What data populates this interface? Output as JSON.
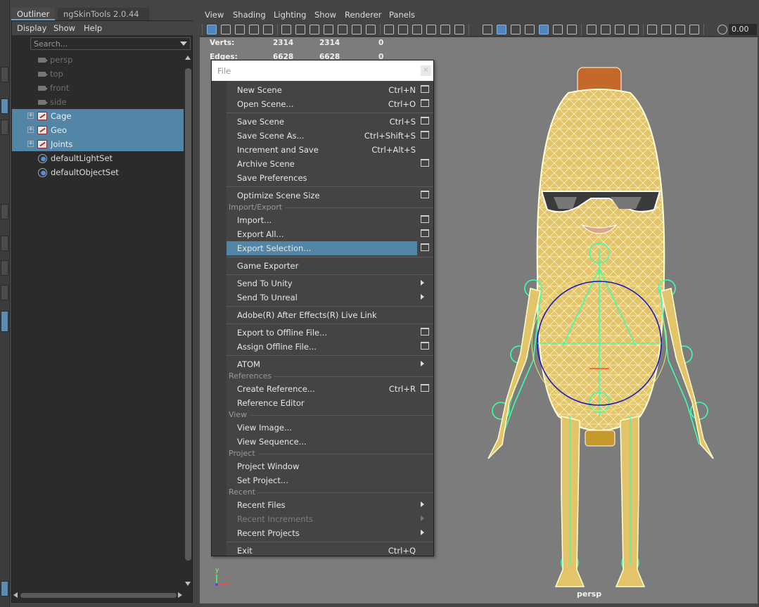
{
  "outliner": {
    "tabs": [
      "Outliner",
      "ngSkinTools 2.0.44"
    ],
    "menu": [
      "Display",
      "Show",
      "Help"
    ],
    "search_placeholder": "Search...",
    "items": [
      {
        "label": "persp",
        "type": "camera",
        "selected": false
      },
      {
        "label": "top",
        "type": "camera",
        "selected": false
      },
      {
        "label": "front",
        "type": "camera",
        "selected": false
      },
      {
        "label": "side",
        "type": "camera",
        "selected": false
      },
      {
        "label": "Cage",
        "type": "group",
        "selected": true
      },
      {
        "label": "Geo",
        "type": "group",
        "selected": true
      },
      {
        "label": "Joints",
        "type": "group",
        "selected": true
      },
      {
        "label": "defaultLightSet",
        "type": "set",
        "selected": false
      },
      {
        "label": "defaultObjectSet",
        "type": "set",
        "selected": false
      }
    ]
  },
  "viewport": {
    "menu": [
      "View",
      "Shading",
      "Lighting",
      "Show",
      "Renderer",
      "Panels"
    ],
    "toolbar_value": "0.00",
    "hud": {
      "verts_label": "Verts:",
      "verts_values": [
        "2314",
        "2314",
        "0"
      ],
      "edges_label": "Edges:",
      "edges_values": [
        "6628",
        "6628",
        "0"
      ]
    },
    "camera_label": "persp",
    "axis_y": "y"
  },
  "file_menu": {
    "title": "File",
    "close": "×",
    "items": [
      {
        "label": "New Scene",
        "shortcut": "Ctrl+N"
      },
      {
        "label": "Open Scene...",
        "shortcut": "Ctrl+O"
      },
      {
        "label": "Save Scene",
        "shortcut": "Ctrl+S"
      },
      {
        "label": "Save Scene As...",
        "shortcut": "Ctrl+Shift+S"
      },
      {
        "label": "Increment and Save",
        "shortcut": "Ctrl+Alt+S"
      },
      {
        "label": "Archive Scene",
        "shortcut": ""
      },
      {
        "label": "Save Preferences",
        "shortcut": ""
      },
      {
        "label": "Optimize Scene Size",
        "shortcut": ""
      },
      {
        "label": "Import...",
        "shortcut": ""
      },
      {
        "label": "Export All...",
        "shortcut": ""
      },
      {
        "label": "Export Selection...",
        "shortcut": ""
      },
      {
        "label": "Game Exporter",
        "shortcut": ""
      },
      {
        "label": "Send To Unity",
        "shortcut": ""
      },
      {
        "label": "Send To Unreal",
        "shortcut": ""
      },
      {
        "label": "Adobe(R) After Effects(R) Live Link",
        "shortcut": ""
      },
      {
        "label": "Export to Offline File...",
        "shortcut": ""
      },
      {
        "label": "Assign Offline File...",
        "shortcut": ""
      },
      {
        "label": "ATOM",
        "shortcut": ""
      },
      {
        "label": "Create Reference...",
        "shortcut": "Ctrl+R"
      },
      {
        "label": "Reference Editor",
        "shortcut": ""
      },
      {
        "label": "View Image...",
        "shortcut": ""
      },
      {
        "label": "View Sequence...",
        "shortcut": ""
      },
      {
        "label": "Project Window",
        "shortcut": ""
      },
      {
        "label": "Set Project...",
        "shortcut": ""
      },
      {
        "label": "Recent Files",
        "shortcut": ""
      },
      {
        "label": "Recent Increments",
        "shortcut": ""
      },
      {
        "label": "Recent Projects",
        "shortcut": ""
      },
      {
        "label": "Exit",
        "shortcut": "Ctrl+Q"
      }
    ],
    "sections": [
      "Import/Export",
      "References",
      "View",
      "Project",
      "Recent"
    ]
  },
  "colors": {
    "selection": "#5285a6",
    "viewport_bg": "#7c7c7c",
    "wire": "#ffffd0",
    "skeleton": "#33ff99"
  }
}
